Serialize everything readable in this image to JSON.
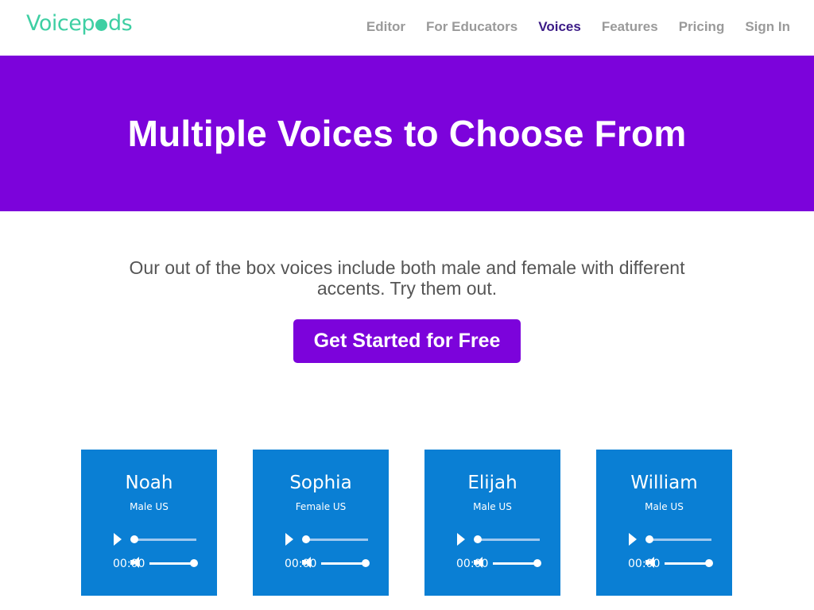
{
  "logo": {
    "text_before": "Voicep",
    "text_after": "ds"
  },
  "nav": {
    "items": [
      {
        "label": "Editor",
        "active": false
      },
      {
        "label": "For Educators",
        "active": false
      },
      {
        "label": "Voices",
        "active": true
      },
      {
        "label": "Features",
        "active": false
      },
      {
        "label": "Pricing",
        "active": false
      },
      {
        "label": "Sign In",
        "active": false
      }
    ]
  },
  "hero": {
    "title": "Multiple Voices to Choose From"
  },
  "intro": {
    "text": "Our out of the box voices include both male and female with different accents. Try them out.",
    "cta_label": "Get Started for Free"
  },
  "voices": [
    {
      "name": "Noah",
      "description": "Male US",
      "time": "00:00",
      "progress": 0,
      "volume": 1
    },
    {
      "name": "Sophia",
      "description": "Female US",
      "time": "00:00",
      "progress": 0,
      "volume": 1
    },
    {
      "name": "Elijah",
      "description": "Male US",
      "time": "00:00",
      "progress": 0,
      "volume": 1
    },
    {
      "name": "William",
      "description": "Male US",
      "time": "00:00",
      "progress": 0,
      "volume": 1
    }
  ],
  "colors": {
    "brand_green": "#3ecfa3",
    "brand_purple": "#7c03db",
    "card_blue": "#0a7fd4",
    "nav_active": "#3b1a86"
  }
}
